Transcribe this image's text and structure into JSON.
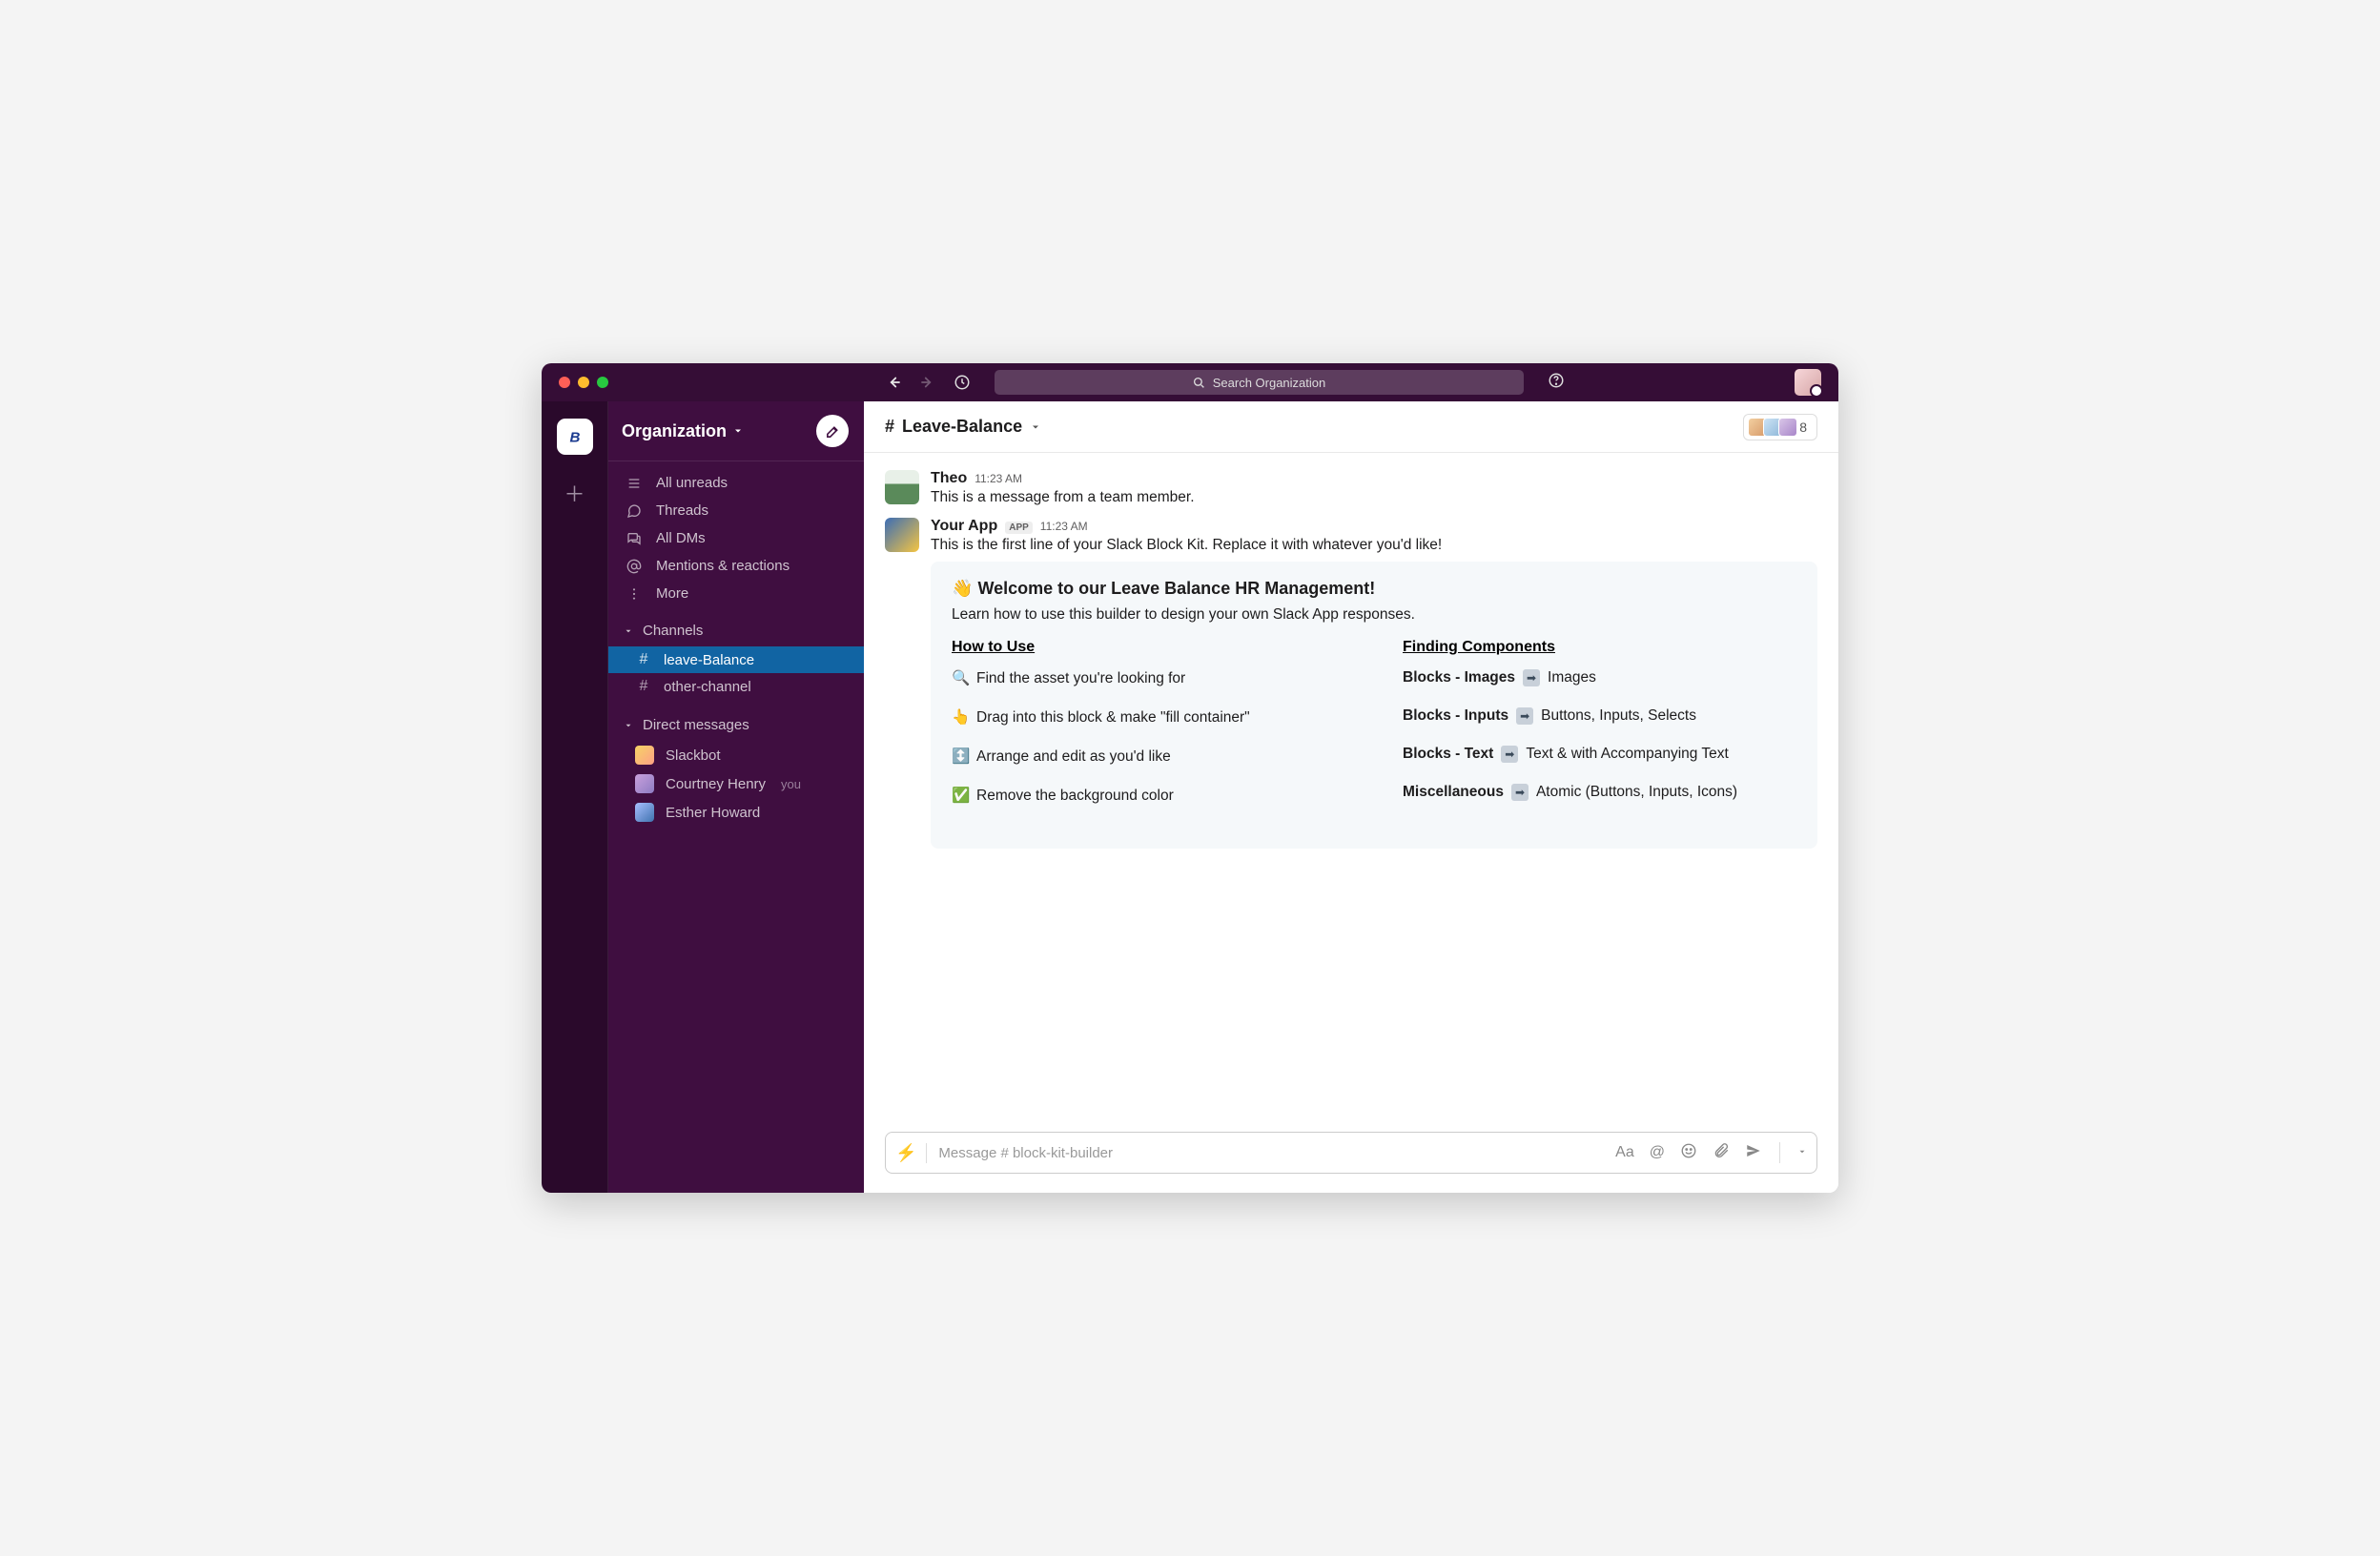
{
  "titlebar": {
    "search_placeholder": "Search Organization"
  },
  "sidebar": {
    "org_name": "Organization",
    "nav": [
      {
        "label": "All unreads"
      },
      {
        "label": "Threads"
      },
      {
        "label": "All DMs"
      },
      {
        "label": "Mentions & reactions"
      },
      {
        "label": "More"
      }
    ],
    "channels_label": "Channels",
    "channels": [
      {
        "name": "leave-Balance",
        "active": true
      },
      {
        "name": "other-channel",
        "active": false
      }
    ],
    "dms_label": "Direct messages",
    "dms": [
      {
        "name": "Slackbot",
        "you": false,
        "color": "linear-gradient(135deg,#f6d365,#fda085)"
      },
      {
        "name": "Courtney Henry",
        "you": true,
        "color": "linear-gradient(135deg,#c9a0dc,#8e7cc3)"
      },
      {
        "name": "Esther Howard",
        "you": false,
        "color": "linear-gradient(135deg,#a8c0ff,#3f72af)"
      }
    ],
    "you_label": "you"
  },
  "channel": {
    "name": "Leave-Balance",
    "member_count": "8"
  },
  "messages": [
    {
      "author": "Theo",
      "time": "11:23 AM",
      "avatar": "linear-gradient(180deg,#e8f0e8 40%,#5a8a5a 40%)",
      "text": "This is a message from a team member."
    },
    {
      "author": "Your App",
      "is_app": true,
      "time": "11:23 AM",
      "avatar": "linear-gradient(135deg,#3b6db5,#f5c542)",
      "text": "This is the first line of your Slack Block Kit. Replace it with whatever you'd like!"
    }
  ],
  "app_badge_label": "APP",
  "block_kit": {
    "title_emoji": "👋",
    "title": "Welcome to our Leave Balance HR Management!",
    "subtitle": "Learn how to use this builder to design your own Slack App responses.",
    "left": {
      "heading": "How to Use",
      "rows": [
        {
          "icon": "🔍",
          "text": "Find the asset you're looking for"
        },
        {
          "icon": "👆",
          "text": "Drag into this block & make \"fill container\""
        },
        {
          "icon": "↕️",
          "text": "Arrange and edit as you'd like"
        },
        {
          "icon": "✅",
          "text": "Remove the background color"
        }
      ]
    },
    "right": {
      "heading": "Finding Components",
      "rows": [
        {
          "bold": "Blocks - Images",
          "arrow": true,
          "rest": "Images"
        },
        {
          "bold": "Blocks - Inputs",
          "arrow": true,
          "rest": "Buttons, Inputs, Selects"
        },
        {
          "bold": "Blocks - Text",
          "arrow": true,
          "rest": "Text & with Accompanying Text"
        },
        {
          "bold": "Miscellaneous",
          "arrow": true,
          "rest": "Atomic (Buttons, Inputs, Icons)"
        }
      ]
    }
  },
  "composer": {
    "placeholder": "Message # block-kit-builder",
    "format_label": "Aa"
  }
}
